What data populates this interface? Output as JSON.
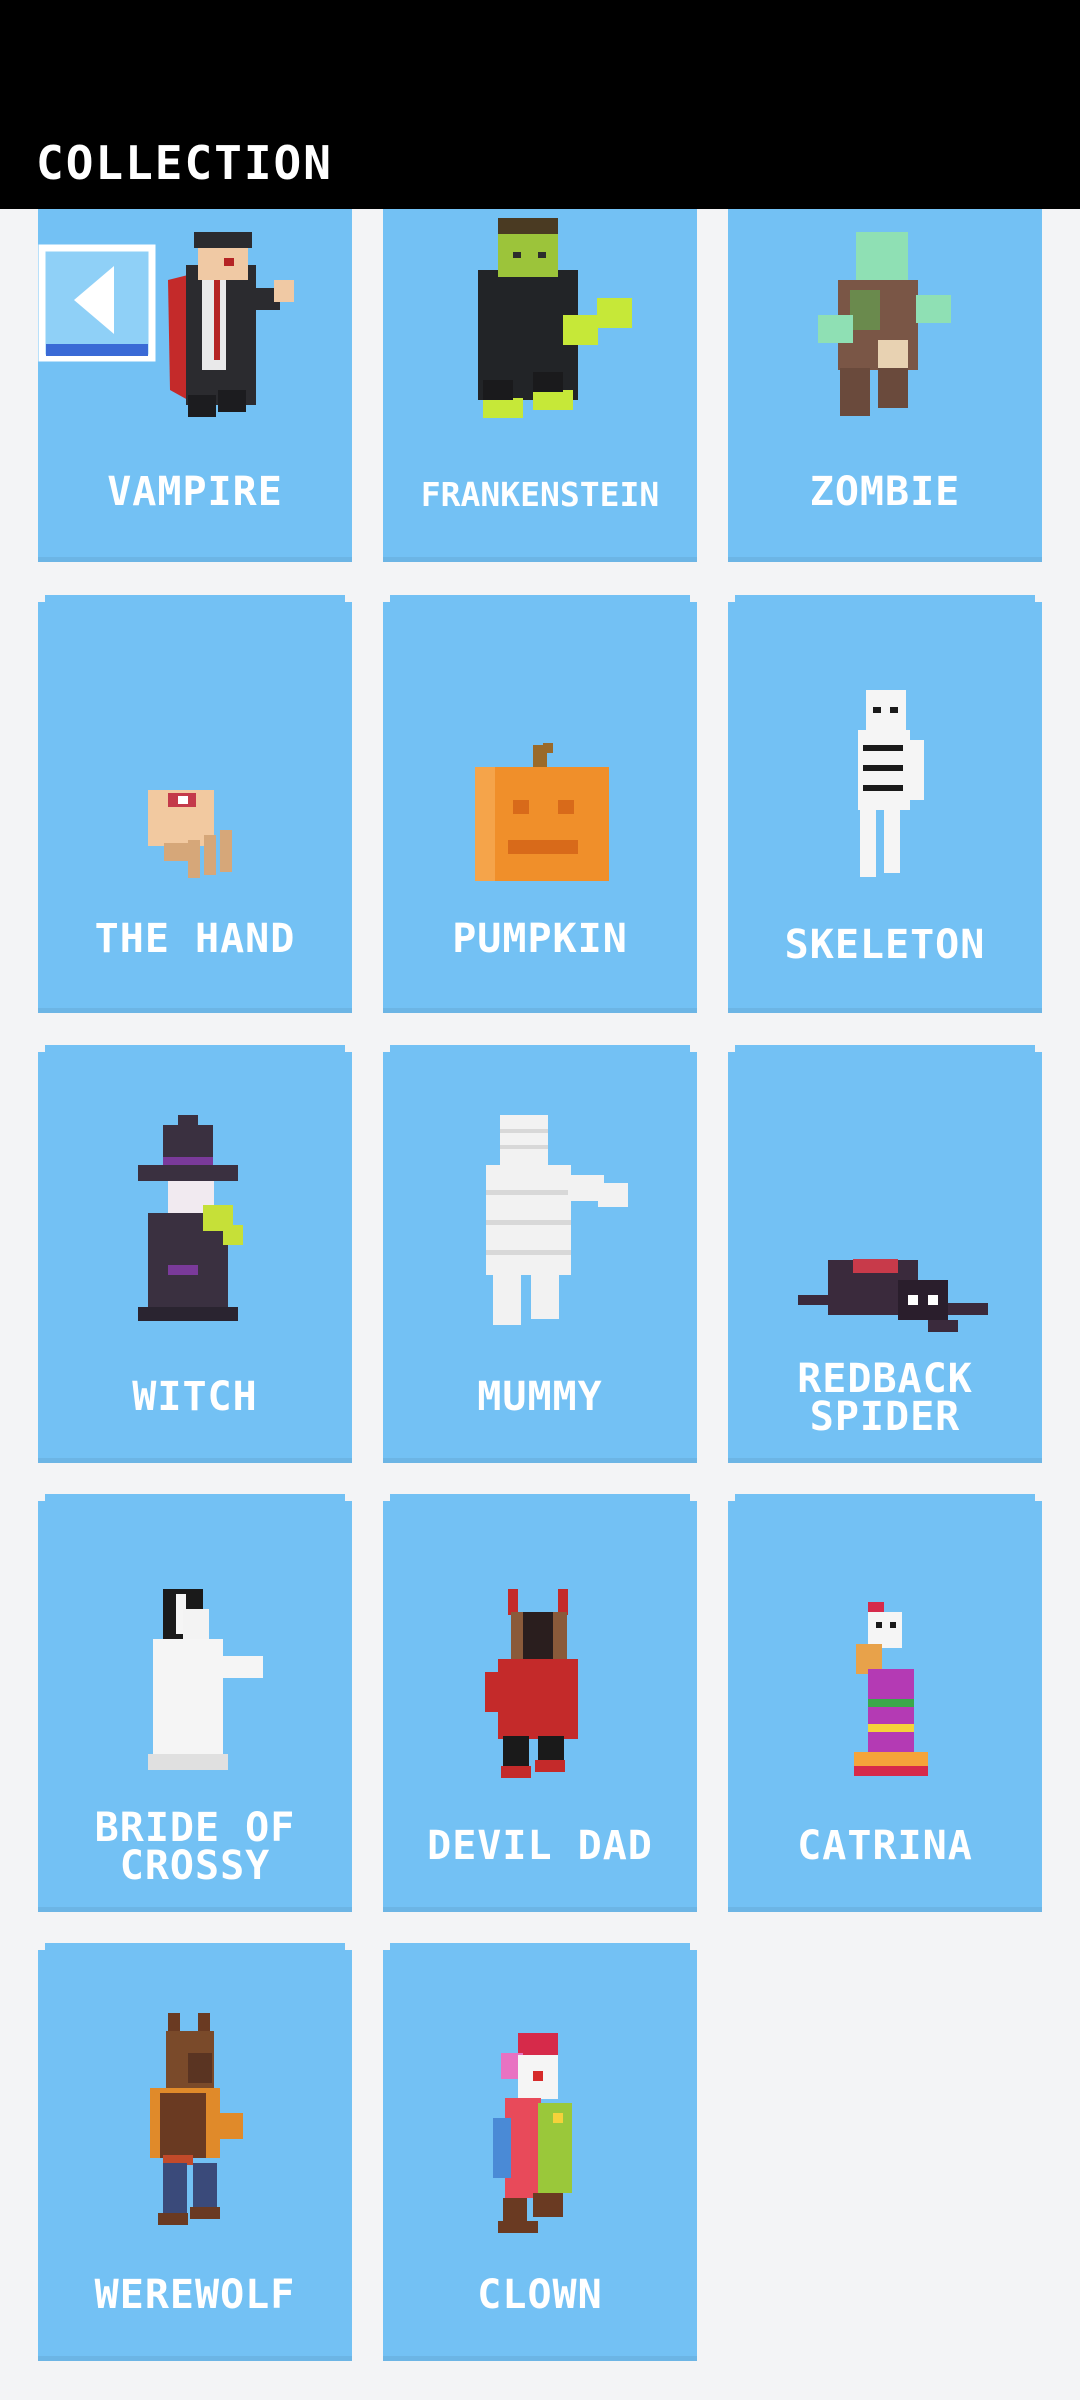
{
  "header": {
    "title": "COLLECTION"
  },
  "back_button": {
    "icon": "back-arrow-icon"
  },
  "colors": {
    "card": "#73c1f4",
    "background": "#f3f4f6",
    "header": "#000000"
  },
  "characters": [
    {
      "name": "VAMPIRE",
      "icon": "vampire-icon"
    },
    {
      "name": "FRANKENSTEIN",
      "icon": "frankenstein-icon"
    },
    {
      "name": "ZOMBIE",
      "icon": "zombie-icon"
    },
    {
      "name": "THE HAND",
      "icon": "hand-icon"
    },
    {
      "name": "PUMPKIN",
      "icon": "pumpkin-icon"
    },
    {
      "name": "SKELETON",
      "icon": "skeleton-icon"
    },
    {
      "name": "WITCH",
      "icon": "witch-icon"
    },
    {
      "name": "MUMMY",
      "icon": "mummy-icon"
    },
    {
      "name": "REDBACK SPIDER",
      "line1": "REDBACK",
      "line2": "SPIDER",
      "icon": "spider-icon"
    },
    {
      "name": "BRIDE OF CROSSY",
      "line1": "BRIDE OF",
      "line2": "CROSSY",
      "icon": "bride-icon"
    },
    {
      "name": "DEVIL DAD",
      "icon": "devil-icon"
    },
    {
      "name": "CATRINA",
      "icon": "catrina-icon"
    },
    {
      "name": "WEREWOLF",
      "icon": "werewolf-icon"
    },
    {
      "name": "CLOWN",
      "icon": "clown-icon"
    }
  ]
}
